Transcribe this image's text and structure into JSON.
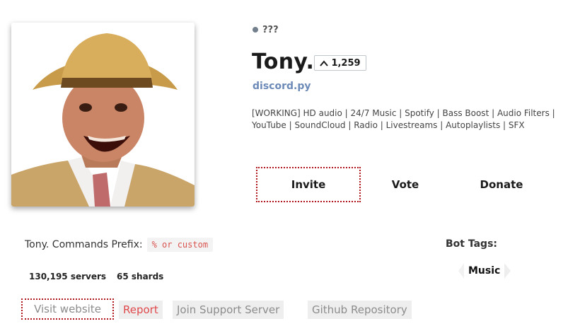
{
  "bot": {
    "status_text": "???",
    "name": "Tony.",
    "votes": "1,259",
    "library": "discord.py",
    "description": "[WORKING] HD audio | 24/7 Music | Spotify | Bass Boost | Audio Filters | YouTube | SoundCloud | Radio | Livestreams | Autoplaylists | SFX"
  },
  "actions": {
    "invite": "Invite",
    "vote": "Vote",
    "donate": "Donate"
  },
  "prefix": {
    "label": "Tony. Commands Prefix:",
    "value": "% or custom"
  },
  "stats": {
    "servers": "130,195 servers",
    "shards": "65 shards"
  },
  "tags": {
    "label": "Bot Tags:",
    "items": [
      "Music"
    ]
  },
  "links": {
    "website": "Visit website",
    "report": "Report",
    "support": "Join Support Server",
    "github": "Github Repository"
  },
  "colors": {
    "accent_red": "#b0161b",
    "library_blue": "#6c8ab8",
    "report_red": "#e0484b",
    "prefix_red": "#d9534f"
  }
}
